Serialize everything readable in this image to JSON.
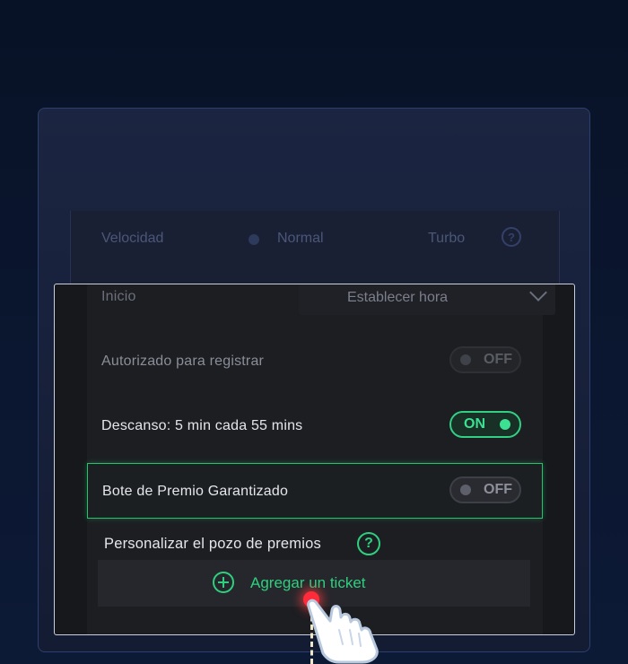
{
  "speed": {
    "label": "Velocidad",
    "options": [
      "Normal",
      "Turbo"
    ]
  },
  "start": {
    "label": "Inicio",
    "select_value": "Establecer hora"
  },
  "authorized": {
    "label": "Autorizado para registrar",
    "toggle_label": "OFF"
  },
  "break": {
    "label": "Descanso: 5 min cada 55 mins",
    "toggle_label": "ON"
  },
  "guaranteed": {
    "label": "Bote de Premio Garantizado",
    "toggle_label": "OFF"
  },
  "customize": {
    "label": "Personalizar el pozo de premios",
    "help_glyph": "?"
  },
  "add_ticket": {
    "label": "Agregar un ticket"
  },
  "icons": [
    "help-icon",
    "chevron-down-icon",
    "plus-circle-icon",
    "hand-pointer-icon"
  ],
  "colors": {
    "accent_green": "#2ed07f",
    "tap_dot": "#ff2a3a",
    "background": "#081226"
  }
}
